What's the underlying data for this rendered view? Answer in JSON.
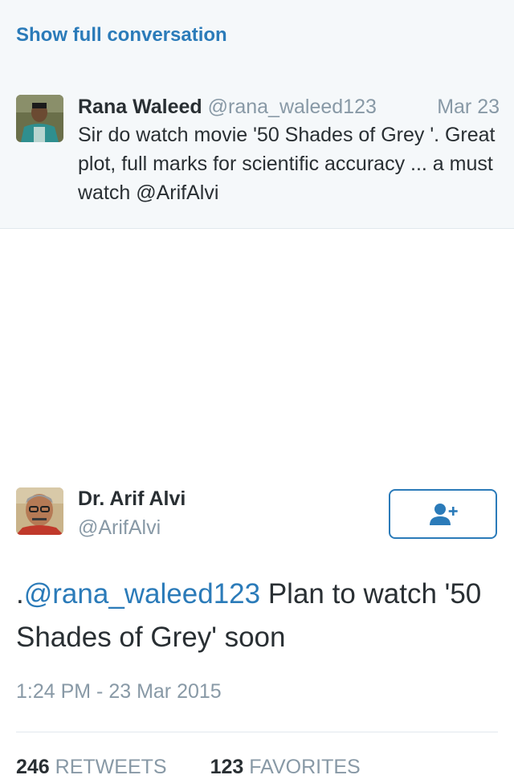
{
  "conversation": {
    "show_full_label": "Show full conversation"
  },
  "reply_tweet": {
    "name": "Rana Waleed",
    "handle": "@rana_waleed123",
    "date": "Mar 23",
    "text": "Sir do watch movie '50 Shades of Grey '. Great plot, full marks for scientific accuracy ... a must watch @ArifAlvi"
  },
  "main_tweet": {
    "name": "Dr. Arif Alvi",
    "handle": "@ArifAlvi",
    "text_prefix": ".",
    "mention": "@rana_waleed123",
    "text_body": " Plan to watch '50 Shades of Grey' soon",
    "timestamp": "1:24 PM - 23 Mar 2015",
    "follow_icon": "follow-user-icon"
  },
  "stats": {
    "retweets_count": "246",
    "retweets_label": "RETWEETS",
    "favorites_count": "123",
    "favorites_label": "FAVORITES"
  },
  "colors": {
    "link_blue": "#2b7bb9",
    "muted_gray": "#8899a6",
    "text_dark": "#292f33",
    "top_bg": "#f5f8fa"
  }
}
